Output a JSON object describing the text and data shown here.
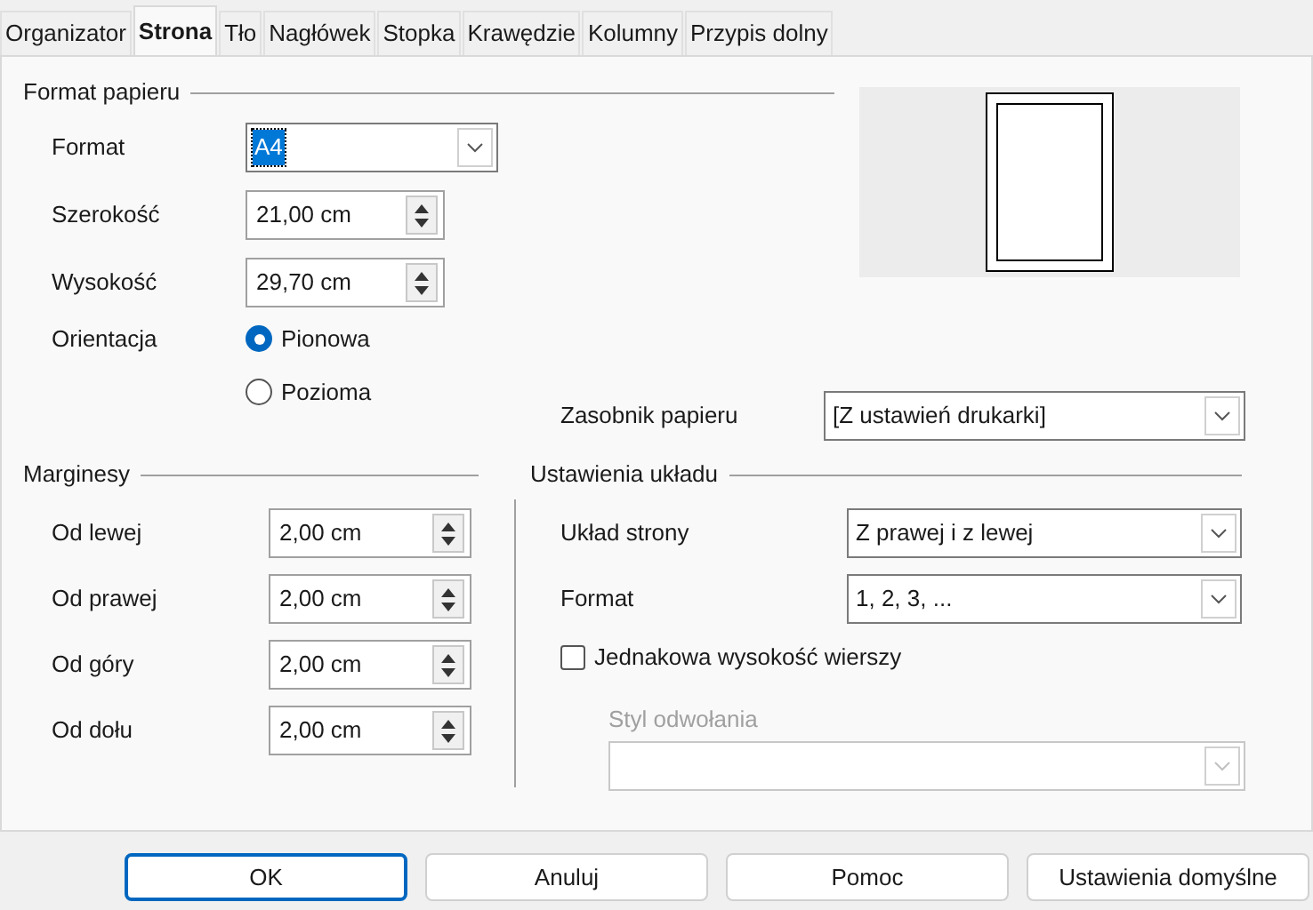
{
  "tabs": [
    {
      "label": "Organizator",
      "selected": false
    },
    {
      "label": "Strona",
      "selected": true
    },
    {
      "label": "Tło",
      "selected": false
    },
    {
      "label": "Nagłówek",
      "selected": false
    },
    {
      "label": "Stopka",
      "selected": false
    },
    {
      "label": "Krawędzie",
      "selected": false
    },
    {
      "label": "Kolumny",
      "selected": false
    },
    {
      "label": "Przypis dolny",
      "selected": false
    }
  ],
  "paper_format": {
    "heading": "Format papieru",
    "format": {
      "label": "Format",
      "value": "A4",
      "focused": true
    },
    "fields": [
      {
        "label": "Szerokość",
        "value": "21,00 cm"
      },
      {
        "label": "Wysokość",
        "value": "29,70 cm"
      }
    ],
    "orientation": {
      "label": "Orientacja",
      "options": [
        {
          "label": "Pionowa",
          "selected": true
        },
        {
          "label": "Pozioma",
          "selected": false
        }
      ]
    },
    "paper_tray": {
      "label": "Zasobnik papieru",
      "value": "[Z ustawień drukarki]"
    }
  },
  "margins": {
    "heading": "Marginesy",
    "fields": [
      {
        "label": "Od lewej",
        "value": "2,00 cm"
      },
      {
        "label": "Od prawej",
        "value": "2,00 cm"
      },
      {
        "label": "Od góry",
        "value": "2,00 cm"
      },
      {
        "label": "Od dołu",
        "value": "2,00 cm"
      }
    ]
  },
  "layout": {
    "heading": "Ustawienia układu",
    "page_layout": {
      "label": "Układ strony",
      "value": "Z prawej i z lewej"
    },
    "format": {
      "label": "Format",
      "value": "1, 2, 3, ..."
    },
    "same_height": {
      "label": "Jednakowa wysokość wierszy",
      "checked": false
    },
    "reference_style": {
      "label": "Styl odwołania",
      "disabled": true
    }
  },
  "buttons": [
    {
      "label": "OK",
      "default": true
    },
    {
      "label": "Anuluj",
      "default": false
    },
    {
      "label": "Pomoc",
      "default": false
    },
    {
      "label": "Ustawienia domyślne",
      "default": false
    }
  ]
}
